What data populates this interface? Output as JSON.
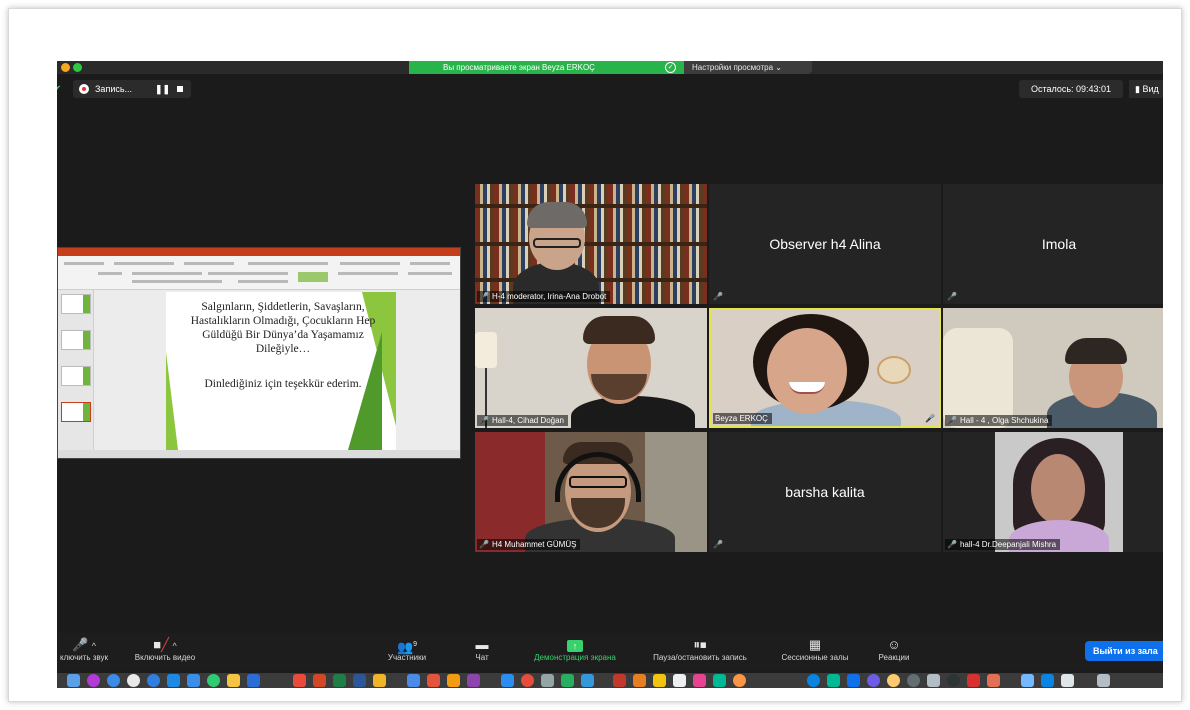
{
  "share_bar": {
    "viewing_text": "Вы просматриваете экран Beyza ERKOÇ",
    "view_options": "Настройки просмотра"
  },
  "recording": {
    "label": "Запись...",
    "pause_glyph": "❚❚"
  },
  "meeting": {
    "time_remaining": "Осталось: 09:43:01",
    "view_button": "Вид"
  },
  "presentation": {
    "slide_text_main": "Salgınların, Şiddetlerin, Savaşların, Hastalıkların Olmadığı, Çocukların Hep Güldüğü Bir Dünya’da Yaşamamız Dileğiyle…",
    "slide_text_thanks": "Dinlediğiniz için teşekkür ederim."
  },
  "participants": [
    {
      "name": "H-4 moderator, Irina-Ana Drobot",
      "video": true
    },
    {
      "name": "Observer h4 Alina",
      "video": false
    },
    {
      "name": "Imola",
      "video": false
    },
    {
      "name": "Hall-4, Cihad Doğan",
      "video": true
    },
    {
      "name": "Beyza ERKOÇ",
      "video": true,
      "active": true
    },
    {
      "name": "Hall - 4 ,  Olga Shchukina",
      "video": true
    },
    {
      "name": "H4 Muhammet GÜMÜŞ",
      "video": true
    },
    {
      "name": "barsha kalita",
      "video": false
    },
    {
      "name": "hall-4 Dr.Deepanjali Mishra",
      "video": true
    }
  ],
  "toolbar": {
    "mute_label": "ключить звук",
    "video_label": "Включить видео",
    "participants_label": "Участники",
    "participants_count": "9",
    "chat_label": "Чат",
    "share_label": "Демонстрация экрана",
    "record_label": "Пауза/остановить запись",
    "breakout_label": "Сессионные залы",
    "reactions_label": "Реакции",
    "leave_label": "Выйти из зала"
  },
  "colors": {
    "share_green": "#29b44b",
    "active_speaker": "#e2e64a",
    "leave_blue": "#0e71eb",
    "muted_red": "#e04141"
  }
}
